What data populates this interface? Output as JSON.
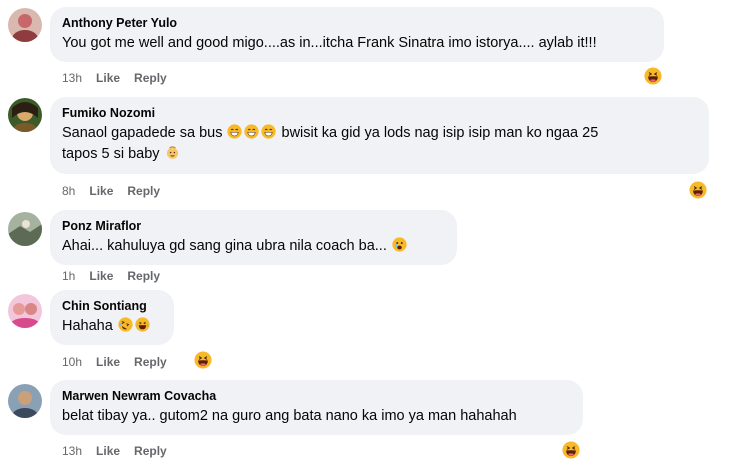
{
  "comments": [
    {
      "name": "Anthony Peter Yulo",
      "text": "You got me well and good migo....as in...itcha Frank Sinatra imo istorya.... aylab it!!!",
      "time": "13h",
      "like": "Like",
      "reply": "Reply",
      "avatar_color": "#c7676b",
      "reaction_icon": "haha-reaction-icon"
    },
    {
      "name": "Fumiko Nozomi",
      "text_line1_a": "Sanaol gapadede sa bus",
      "text_line1_b": "bwisit ka gid ya lods nag isip isip man ko ngaa 25",
      "text_line2": "tapos 5 si baby",
      "time": "8h",
      "like": "Like",
      "reply": "Reply",
      "avatar_color": "#6b5a2a",
      "reaction_icon": "haha-reaction-icon"
    },
    {
      "name": "Ponz Miraflor",
      "text": "Ahai... kahuluya gd sang gina ubra nila coach ba...",
      "time": "1h",
      "like": "Like",
      "reply": "Reply",
      "avatar_color": "#7d8a7a"
    },
    {
      "name": "Chin Sontiang",
      "text": "Hahaha",
      "time": "10h",
      "like": "Like",
      "reply": "Reply",
      "avatar_color": "#e07fb0",
      "reaction_icon": "haha-reaction-icon"
    },
    {
      "name": "Marwen Newram Covacha",
      "text": "belat tibay ya.. gutom2 na guro ang bata nano ka imo ya man hahahah",
      "time": "13h",
      "like": "Like",
      "reply": "Reply",
      "avatar_color": "#5b6d84",
      "reaction_icon": "haha-reaction-icon"
    }
  ],
  "colors": {
    "bubble": "#f0f2f5",
    "meta": "#65676b",
    "emoji": "#f7b928"
  }
}
